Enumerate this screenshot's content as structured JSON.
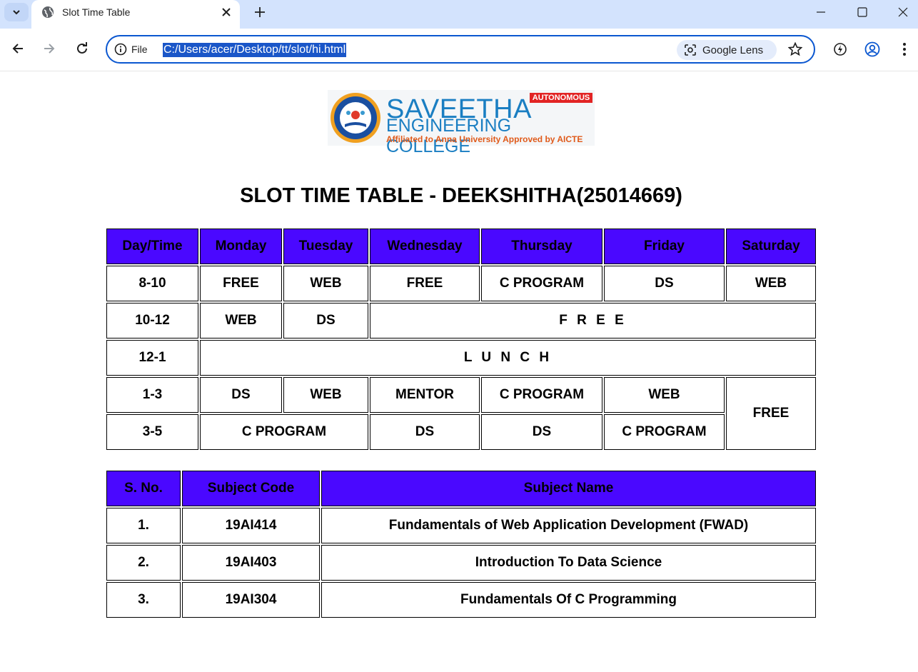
{
  "browser": {
    "tab_title": "Slot Time Table",
    "site_info_label": "File",
    "url": "C:/Users/acer/Desktop/tt/slot/hi.html",
    "lens_label": "Google Lens"
  },
  "logo": {
    "line1": "SAVEETHA",
    "line2": "ENGINEERING COLLEGE",
    "line3": "Affiliated to Anna University  Approved by AICTE",
    "badge": "AUTONOMOUS"
  },
  "page": {
    "title": "SLOT TIME TABLE - DEEKSHITHA(25014669)"
  },
  "timetable": {
    "headers": [
      "Day/Time",
      "Monday",
      "Tuesday",
      "Wednesday",
      "Thursday",
      "Friday",
      "Saturday"
    ],
    "rows": [
      {
        "time": "8-10",
        "cells": [
          "FREE",
          "WEB",
          "FREE",
          "C PROGRAM",
          "DS",
          "WEB"
        ]
      },
      {
        "time": "10-12",
        "cells": [
          "WEB",
          "DS",
          "F R E E"
        ]
      },
      {
        "time": "12-1",
        "cells": [
          "L U N C H"
        ]
      },
      {
        "time": "1-3",
        "cells": [
          "DS",
          "WEB",
          "MENTOR",
          "C PROGRAM",
          "WEB",
          "FREE"
        ]
      },
      {
        "time": "3-5",
        "cells": [
          "C PROGRAM",
          "DS",
          "DS",
          "C PROGRAM"
        ]
      }
    ]
  },
  "subjects": {
    "headers": [
      "S. No.",
      "Subject Code",
      "Subject Name"
    ],
    "rows": [
      {
        "sno": "1.",
        "code": "19AI414",
        "name": "Fundamentals of Web Application Development (FWAD)"
      },
      {
        "sno": "2.",
        "code": "19AI403",
        "name": "Introduction To Data Science"
      },
      {
        "sno": "3.",
        "code": "19AI304",
        "name": "Fundamentals Of C Programming"
      }
    ]
  },
  "colors": {
    "header_bg": "#4a08ff",
    "url_highlight": "#1a56c8"
  }
}
